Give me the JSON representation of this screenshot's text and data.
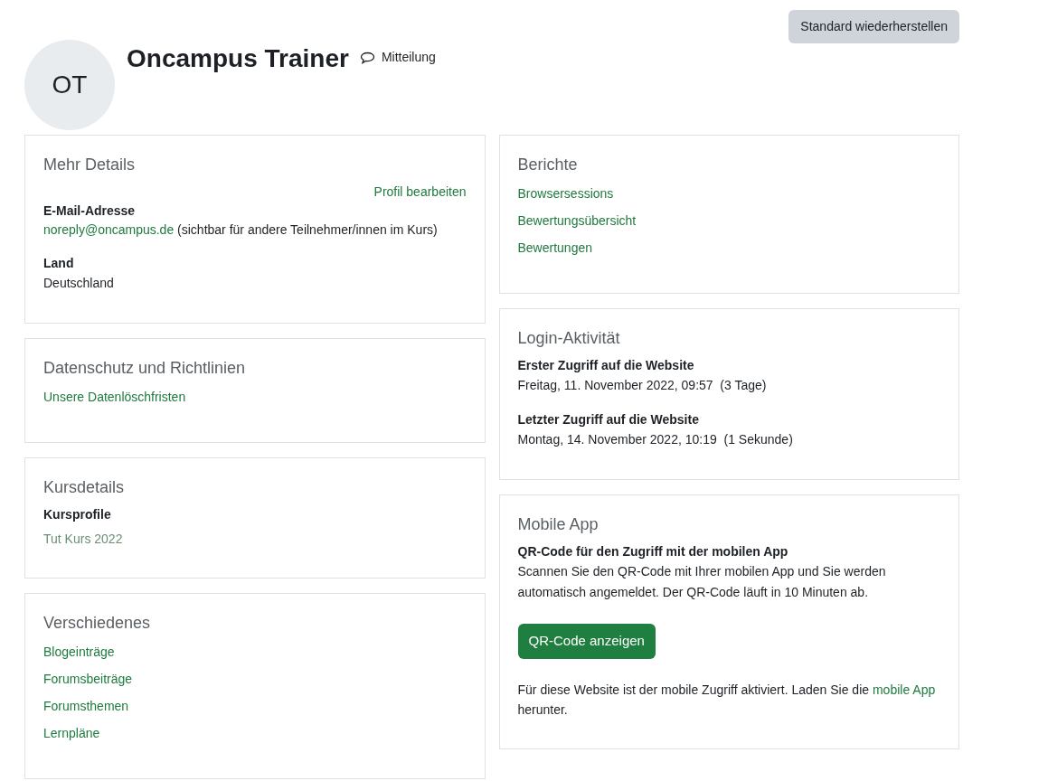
{
  "reset_button": "Standard wiederherstellen",
  "profile": {
    "initials": "OT",
    "name": "Oncampus Trainer",
    "message_link": "Mitteilung"
  },
  "left_cards": [
    {
      "title": "Mehr Details",
      "blocks": [
        {
          "kind": "action",
          "text": "Profil bearbeiten"
        },
        {
          "kind": "field",
          "label": "E-Mail-Adresse",
          "link": "noreply@oncampus.de",
          "value": "(sichtbar für andere Teilnehmer/innen im Kurs)"
        },
        {
          "kind": "field",
          "label": "Land",
          "value": "Deutschland"
        }
      ]
    },
    {
      "title": "Datenschutz und Richtlinien",
      "blocks": [
        {
          "kind": "link",
          "text": "Unsere Datenlöschfristen"
        }
      ]
    },
    {
      "title": "Kursdetails",
      "blocks": [
        {
          "kind": "field",
          "label": "Kursprofile",
          "link": "Tut Kurs 2022",
          "dimmed": true
        }
      ]
    },
    {
      "title": "Verschiedenes",
      "blocks": [
        {
          "kind": "link",
          "text": "Blogeinträge"
        },
        {
          "kind": "link",
          "text": "Forumsbeiträge"
        },
        {
          "kind": "link",
          "text": "Forumsthemen"
        },
        {
          "kind": "link",
          "text": "Lernpläne"
        }
      ]
    }
  ],
  "right_cards": [
    {
      "title": "Berichte",
      "blocks": [
        {
          "kind": "link",
          "text": "Browsersessions"
        },
        {
          "kind": "link",
          "text": "Bewertungsübersicht"
        },
        {
          "kind": "link",
          "text": "Bewertungen"
        }
      ]
    },
    {
      "title": "Login-Aktivität",
      "blocks": [
        {
          "kind": "field",
          "label": "Erster Zugriff auf die Website",
          "value": "Freitag, 11. November 2022, 09:57  (3 Tage)"
        },
        {
          "kind": "field",
          "label": "Letzter Zugriff auf die Website",
          "value": "Montag, 14. November 2022, 10:19  (1 Sekunde)"
        }
      ]
    },
    {
      "title": "Mobile App",
      "blocks": [
        {
          "kind": "field",
          "label": "QR-Code für den Zugriff mit der mobilen App",
          "value": "Scannen Sie den QR-Code mit Ihrer mobilen App und Sie werden automatisch angemeldet. Der QR-Code läuft in 10 Minuten ab."
        },
        {
          "kind": "button",
          "text": "QR-Code anzeigen"
        },
        {
          "kind": "paragraph",
          "before": "Für diese Website ist der mobile Zugriff aktiviert. Laden Sie die",
          "link": "mobile App",
          "after": "herunter."
        }
      ]
    }
  ]
}
